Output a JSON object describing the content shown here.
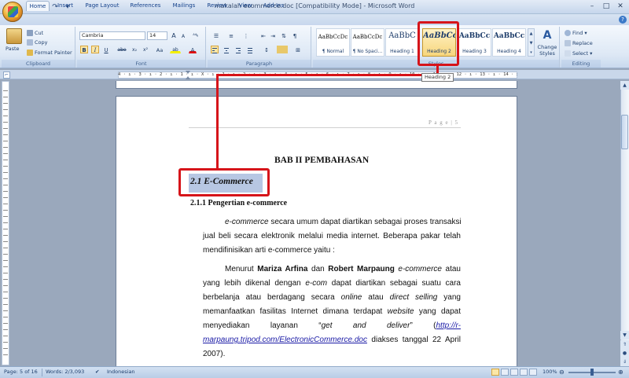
{
  "window": {
    "title": "makalah ecommerce.doc [Compatibility Mode] - Microsoft Word"
  },
  "quick_access": {
    "save": "💾",
    "undo": "↶",
    "redo": "↷"
  },
  "tabs": [
    "Home",
    "Insert",
    "Page Layout",
    "References",
    "Mailings",
    "Review",
    "View",
    "Add-Ins"
  ],
  "clipboard": {
    "paste": "Paste",
    "cut": "Cut",
    "copy": "Copy",
    "format_painter": "Format Painter",
    "label": "Clipboard"
  },
  "font": {
    "family": "Cambria",
    "size": "14",
    "grow": "A",
    "shrink": "A",
    "label": "Font",
    "bold": "B",
    "italic": "I",
    "underline": "U",
    "strike": "abe",
    "sub": "x₂",
    "sup": "x²",
    "case": "Aa",
    "highlight": "ab",
    "color": "A"
  },
  "paragraph": {
    "label": "Paragraph"
  },
  "styles": {
    "label": "Styles",
    "items": [
      {
        "preview": "AaBbCcDc",
        "name": "¶ Normal"
      },
      {
        "preview": "AaBbCcDc",
        "name": "¶ No Spaci..."
      },
      {
        "preview": "AaBbC",
        "name": "Heading 1"
      },
      {
        "preview": "AaBbCc",
        "name": "Heading 2"
      },
      {
        "preview": "AaBbCc",
        "name": "Heading 3"
      },
      {
        "preview": "AaBbCc",
        "name": "Heading 4"
      }
    ],
    "change_styles": "Change Styles"
  },
  "editing": {
    "find": "Find",
    "replace": "Replace",
    "select": "Select",
    "label": "Editing"
  },
  "ruler": {
    "text": "4 · ı · 3 · ı · 2 · ı · 1 · ı · X · ı · 1 · ı · 2 · ı · 3 · ı · 4 · ı · 5 · ı · 6 · ı · 7 · ı · 8 · ı · 9 · ı · 10 · ı · 11 · ı · 12 · ı · 13 · ı · 14 · ı · 15 · ı · 16 · ı · 17 · ı"
  },
  "tooltip": "Heading 2",
  "document": {
    "header": "P a g e | 5",
    "chapter": "BAB II PEMBAHASAN",
    "heading2": "2.1 E-Commerce",
    "heading3": "2.1.1 Pengertian e-commerce",
    "p1": {
      "l1_em": "e-commerce",
      "l1_rest": " secara umum dapat diartikan sebagai proses transaksi",
      "l2": "jual beli secara elektronik melalui media internet. Beberapa pakar telah",
      "l3": "mendifinisikan arti e-commerce yaitu :"
    },
    "p2": {
      "l1_a": "Menurut ",
      "l1_b": "Mariza Arfina",
      "l1_c": " dan ",
      "l1_d": "Robert Marpaung",
      "l1_e": " ",
      "l1_f": "e-commerce",
      "l1_g": " atau",
      "l2_a": "yang lebih dikenal dengan ",
      "l2_b": "e-com",
      "l2_c": " dapat diartikan sebagai suatu cara",
      "l3_a": "berbelanja atau berdagang secara ",
      "l3_b": "online",
      "l3_c": " atau ",
      "l3_d": "direct selling",
      "l3_e": " yang",
      "l4_a": "memanfaatkan fasilitas Internet dimana terdapat ",
      "l4_b": "website",
      "l4_c": " yang dapat",
      "l5_a": "menyediakan layanan “",
      "l5_b": "get and deliver",
      "l5_c": "” (",
      "l5_d": "http://r-",
      "l6_a": "marpaung.tripod.com/ElectronicCommerce.doc",
      "l6_b": " diakses tanggal 22 April",
      "l7": "2007)."
    }
  },
  "status": {
    "page": "Page: 5 of 16",
    "words": "Words: 2/3,093",
    "language": "Indonesian",
    "zoom": "100%"
  },
  "colors": {
    "highlight_red": "#d6141a",
    "selection": "#b7c7e3",
    "accent": "#15428b"
  }
}
